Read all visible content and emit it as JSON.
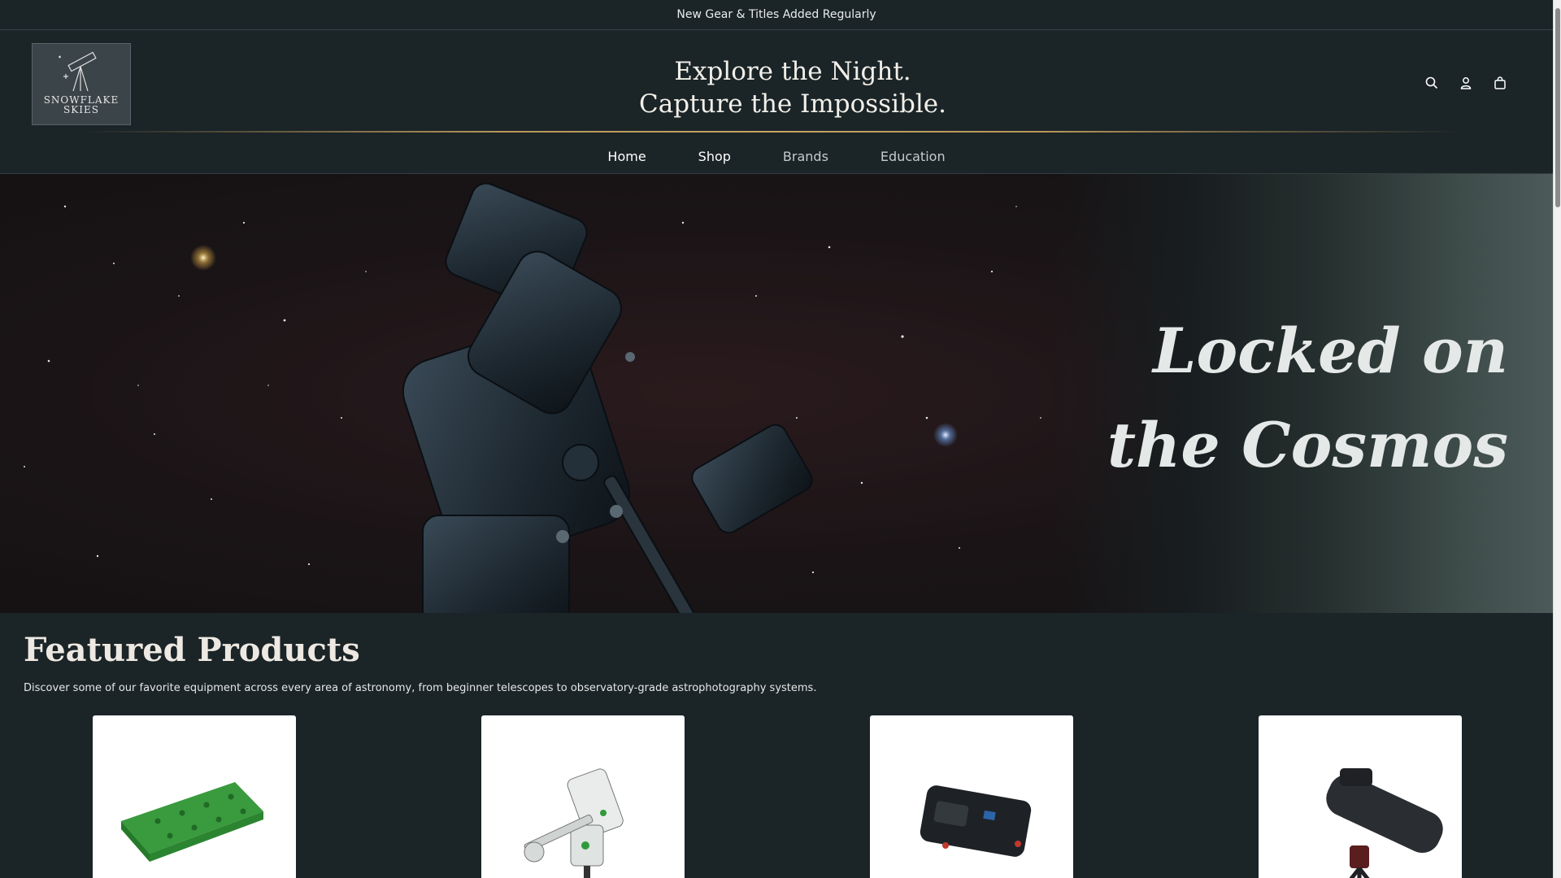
{
  "announcement": "New Gear & Titles Added Regularly",
  "brand": {
    "name_line1": "SNOWFLAKE",
    "name_line2": "SKIES"
  },
  "tagline": {
    "line1": "Explore the Night.",
    "line2": "Capture the Impossible."
  },
  "header_icons": [
    "search-icon",
    "account-icon",
    "cart-icon"
  ],
  "nav": [
    {
      "label": "Home"
    },
    {
      "label": "Shop"
    },
    {
      "label": "Brands"
    },
    {
      "label": "Education"
    }
  ],
  "hero": {
    "line1": "Locked on",
    "line2": "the Cosmos"
  },
  "featured": {
    "title": "Featured Products",
    "description": "Discover some of our favorite equipment across every area of astronomy, from beginner telescopes to observatory-grade astrophotography systems."
  },
  "products": [
    {
      "image": "green-dovetail-plate"
    },
    {
      "image": "equatorial-mount"
    },
    {
      "image": "camera-controller"
    },
    {
      "image": "reflector-telescope"
    }
  ],
  "colors": {
    "background": "#1b2427",
    "accent_gold": "#b7965a",
    "card": "#ffffff"
  }
}
